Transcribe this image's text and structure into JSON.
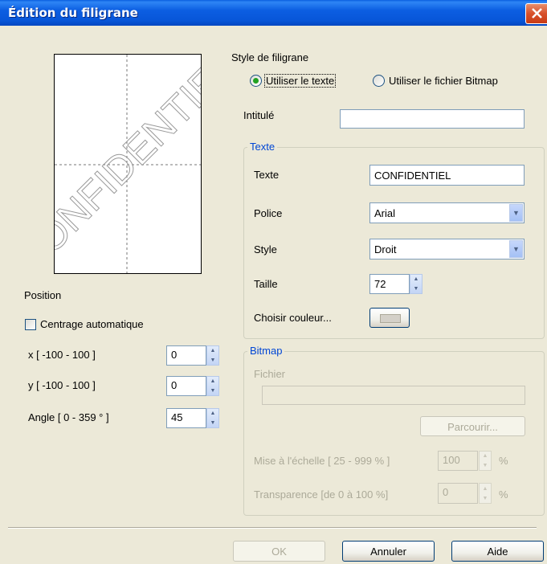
{
  "window": {
    "title": "Édition du filigrane"
  },
  "preview": {
    "watermark_text": "CONFIDENTIEL"
  },
  "style_filigrane": {
    "label": "Style de filigrane",
    "option_text": "Utiliser le texte",
    "option_bitmap": "Utiliser le fichier Bitmap"
  },
  "intitule": {
    "label": "Intitulé",
    "value": ""
  },
  "texte_group": {
    "title": "Texte",
    "texte_label": "Texte",
    "texte_value": "CONFIDENTIEL",
    "police_label": "Police",
    "police_value": "Arial",
    "style_label": "Style",
    "style_value": "Droit",
    "taille_label": "Taille",
    "taille_value": "72",
    "couleur_label": "Choisir couleur..."
  },
  "bitmap_group": {
    "title": "Bitmap",
    "fichier_label": "Fichier",
    "fichier_value": "",
    "parcourir_label": "Parcourir...",
    "echelle_label": "Mise à l'échelle [ 25 - 999 % ]",
    "echelle_value": "100",
    "echelle_unit": "%",
    "transparence_label": "Transparence [de 0 à 100 %]",
    "transparence_value": "0",
    "transparence_unit": "%"
  },
  "position": {
    "label": "Position",
    "centrage_label": "Centrage automatique",
    "x_label": "x [ -100  -  100 ]",
    "x_value": "0",
    "y_label": "y [ -100  -  100 ]",
    "y_value": "0",
    "angle_label": "Angle [ 0 - 359 ° ]",
    "angle_value": "45"
  },
  "buttons": {
    "ok": "OK",
    "annuler": "Annuler",
    "aide": "Aide"
  },
  "colors": {
    "selected_color_swatch": "#d4d0c8",
    "title_bar": "#0a5fe0",
    "radio_dot": "#21a121"
  }
}
